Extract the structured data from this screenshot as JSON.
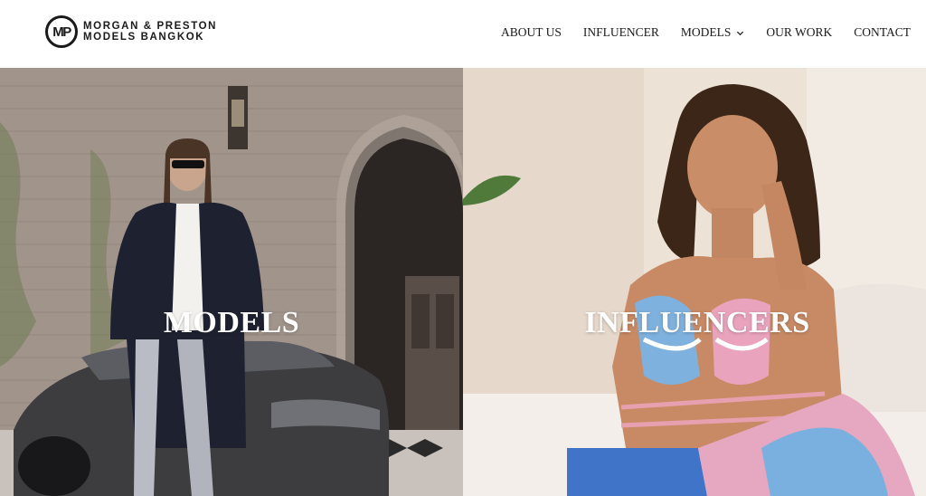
{
  "brand": {
    "monogram": "MP",
    "line1": "MORGAN & PRESTON",
    "line2": "MODELS BANGKOK"
  },
  "nav": {
    "about": "ABOUT US",
    "influencer": "INFLUENCER",
    "models": "MODELS",
    "our_work": "OUR WORK",
    "contact": "CONTACT"
  },
  "panels": {
    "left_title": "MODELS",
    "right_title": "INFLUENCERS"
  },
  "colors": {
    "text_dark": "#1a1a1a",
    "panel_title": "#ffffff"
  }
}
